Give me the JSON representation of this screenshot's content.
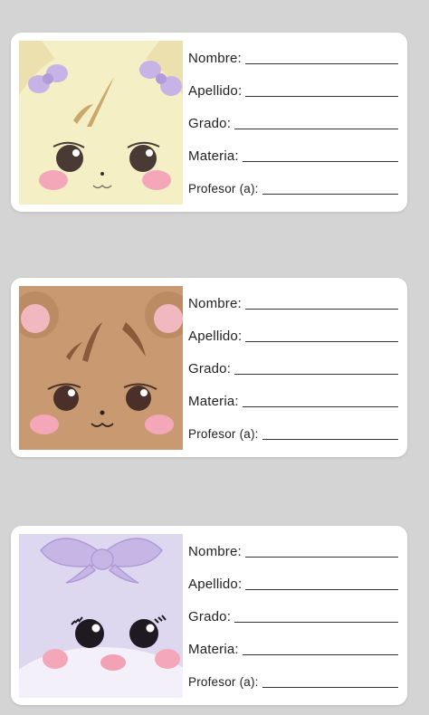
{
  "cards": [
    {
      "animal": "cat",
      "colors": {
        "face": "#f5efc6",
        "ears": "#e8dca6",
        "bow": "#c7b3e6",
        "hair": "#c9a86a",
        "cheeks": "#f4a7b9"
      },
      "fields": [
        {
          "label": "Nombre:"
        },
        {
          "label": "Apellido:"
        },
        {
          "label": "Grado:"
        },
        {
          "label": "Materia:"
        },
        {
          "label": "Profesor (a):"
        }
      ]
    },
    {
      "animal": "bear",
      "colors": {
        "face": "#c99a72",
        "ears": "#b98a62",
        "inner_ears": "#f2b8c0",
        "hair": "#8a5a3a",
        "cheeks": "#f4a7b9"
      },
      "fields": [
        {
          "label": "Nombre:"
        },
        {
          "label": "Apellido:"
        },
        {
          "label": "Grado:"
        },
        {
          "label": "Materia:"
        },
        {
          "label": "Profesor (a):"
        }
      ]
    },
    {
      "animal": "bunny",
      "colors": {
        "face": "#ddd7ef",
        "bow": "#c6b6e6",
        "cheeks": "#f4a7b9",
        "nose": "#f2a2b4"
      },
      "fields": [
        {
          "label": "Nombre:"
        },
        {
          "label": "Apellido:"
        },
        {
          "label": "Grado:"
        },
        {
          "label": "Materia:"
        },
        {
          "label": "Profesor (a):"
        }
      ]
    }
  ]
}
